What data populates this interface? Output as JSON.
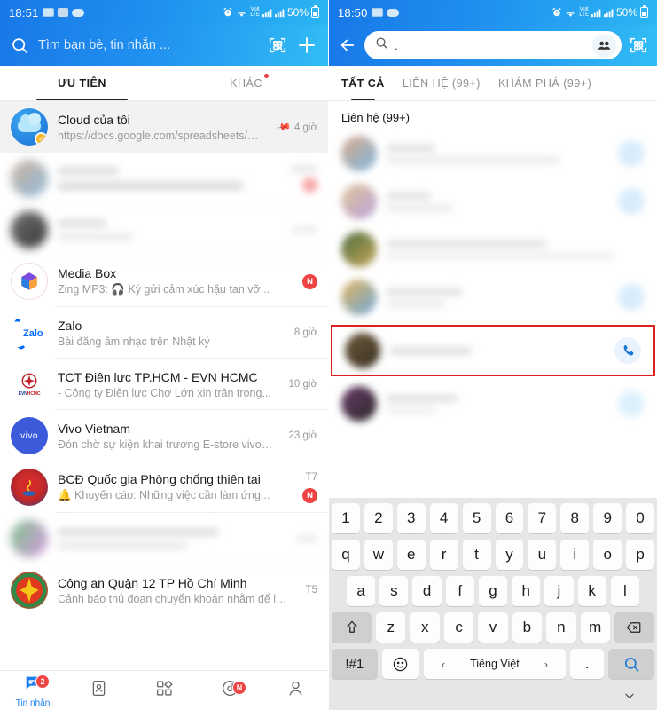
{
  "left": {
    "status": {
      "time": "18:51",
      "battery": "50%",
      "icons": [
        "badge-icon",
        "image-icon",
        "cloud-icon",
        "alarm-icon",
        "wifi-icon",
        "volte-icon",
        "signal-icon",
        "signal2-icon",
        "battery-icon"
      ]
    },
    "appbar": {
      "search_placeholder": "Tìm bạn bè, tin nhắn ...",
      "search_icon": "search-icon",
      "qr_icon": "qr-scan-icon",
      "add_icon": "plus-icon"
    },
    "tabs": [
      {
        "label": "ƯU TIÊN",
        "active": true,
        "dot": false
      },
      {
        "label": "KHÁC",
        "active": false,
        "dot": true
      }
    ],
    "conversations": [
      {
        "name": "Cloud của tôi",
        "preview": "https://docs.google.com/spreadsheets/d...",
        "time": "4 giờ",
        "pinned": true,
        "pin_icon": "pin-icon",
        "avatar": "cloud-avatar",
        "badge": ""
      },
      {
        "name": "",
        "preview": "",
        "time": "",
        "blurred": true,
        "avatar": "blurred-avatar",
        "badge": "blurred"
      },
      {
        "name": "",
        "preview": "",
        "time": "",
        "blurred": true,
        "avatar": "blurred-avatar",
        "badge": ""
      },
      {
        "name": "Media Box",
        "preview": "Zing MP3: 🎧 Ký gửi cảm xúc hậu tan vỡ...",
        "time": "",
        "avatar": "media-box-avatar",
        "badge": "N"
      },
      {
        "name": "Zalo",
        "preview": "Bài đăng âm nhạc trên Nhật ký",
        "time": "8 giờ",
        "avatar": "zalo-avatar",
        "badge": ""
      },
      {
        "name": "TCT Điện lực TP.HCM - EVN HCMC",
        "preview": "- Công ty Điện lực Chợ Lớn xin trân trọng...",
        "time": "10 giờ",
        "avatar": "evn-avatar",
        "badge": ""
      },
      {
        "name": "Vivo Vietnam",
        "preview": "Đón chờ sự kiện khai trương E-store vivo Việt...",
        "time": "23 giờ",
        "avatar": "vivo-avatar",
        "badge": ""
      },
      {
        "name": "BCĐ Quốc gia Phòng chống thiên tai",
        "preview": "🔔 Khuyến cáo: Những việc cần làm ứng...",
        "time": "T7",
        "avatar": "emblem-avatar",
        "badge": "N"
      },
      {
        "name": "",
        "preview": "",
        "time": "",
        "blurred": true,
        "avatar": "blurred-avatar",
        "badge": ""
      },
      {
        "name": "Công an Quận 12 TP Hồ Chí Minh",
        "preview": "Cảnh báo thủ đoạn chuyển khoản nhằm để lừa...",
        "time": "T5",
        "avatar": "police-avatar",
        "badge": ""
      }
    ],
    "bottom_nav": [
      {
        "label": "Tin nhắn",
        "icon": "message-icon",
        "badge": "2",
        "active": true
      },
      {
        "label": "",
        "icon": "contacts-icon",
        "badge": "",
        "active": false
      },
      {
        "label": "",
        "icon": "apps-grid-icon",
        "badge": "",
        "active": false
      },
      {
        "label": "",
        "icon": "clock-feed-icon",
        "badge": "N",
        "active": false
      },
      {
        "label": "",
        "icon": "profile-icon",
        "badge": "",
        "active": false
      }
    ]
  },
  "right": {
    "status": {
      "time": "18:50",
      "battery": "50%"
    },
    "searchbar": {
      "back_icon": "back-arrow-icon",
      "search_icon": "search-icon",
      "value": ".",
      "group_icon": "group-people-icon",
      "qr_icon": "qr-scan-icon"
    },
    "tabs": [
      {
        "label": "TẤT CẢ",
        "active": true
      },
      {
        "label": "LIÊN HỆ (99+)",
        "active": false
      },
      {
        "label": "KHÁM PHÁ (99+)",
        "active": false
      }
    ],
    "section_title": "Liên hệ ",
    "section_count": "(99+)",
    "contacts": [
      {
        "name": "",
        "sub": "",
        "blurred": true,
        "action_icon": "call-icon-faded",
        "highlighted": false
      },
      {
        "name": "",
        "sub": "",
        "blurred": true,
        "action_icon": "call-icon-faded",
        "highlighted": false
      },
      {
        "name": "",
        "sub": "",
        "blurred": true,
        "action_icon": "",
        "highlighted": false
      },
      {
        "name": "",
        "sub": "",
        "blurred": true,
        "action_icon": "call-icon-faded",
        "highlighted": false
      },
      {
        "name": "",
        "sub": "",
        "blurred": true,
        "action_icon": "call-icon",
        "highlighted": true
      },
      {
        "name": "",
        "sub": "",
        "blurred": true,
        "action_icon": "call-icon-faded",
        "highlighted": false
      }
    ],
    "keyboard": {
      "row1": [
        "1",
        "2",
        "3",
        "4",
        "5",
        "6",
        "7",
        "8",
        "9",
        "0"
      ],
      "row2": [
        "q",
        "w",
        "e",
        "r",
        "t",
        "y",
        "u",
        "i",
        "o",
        "p"
      ],
      "row3": [
        "a",
        "s",
        "d",
        "f",
        "g",
        "h",
        "j",
        "k",
        "l"
      ],
      "row4": [
        "z",
        "x",
        "c",
        "v",
        "b",
        "n",
        "m"
      ],
      "shift_icon": "shift-icon",
      "backspace_icon": "backspace-icon",
      "symbols_label": "!#1",
      "emoji_icon": "emoji-icon",
      "space_label": "Tiếng Việt",
      "prev_icon": "chevron-left-icon",
      "next_icon": "chevron-right-icon",
      "period_label": ".",
      "search_icon": "search-key-icon",
      "hide_icon": "chevron-down-icon"
    }
  },
  "colors": {
    "brand_blue": "#1878e8",
    "accent_cyan": "#31bdf6",
    "badge_red": "#ef4444",
    "highlight_red": "#e02020"
  }
}
